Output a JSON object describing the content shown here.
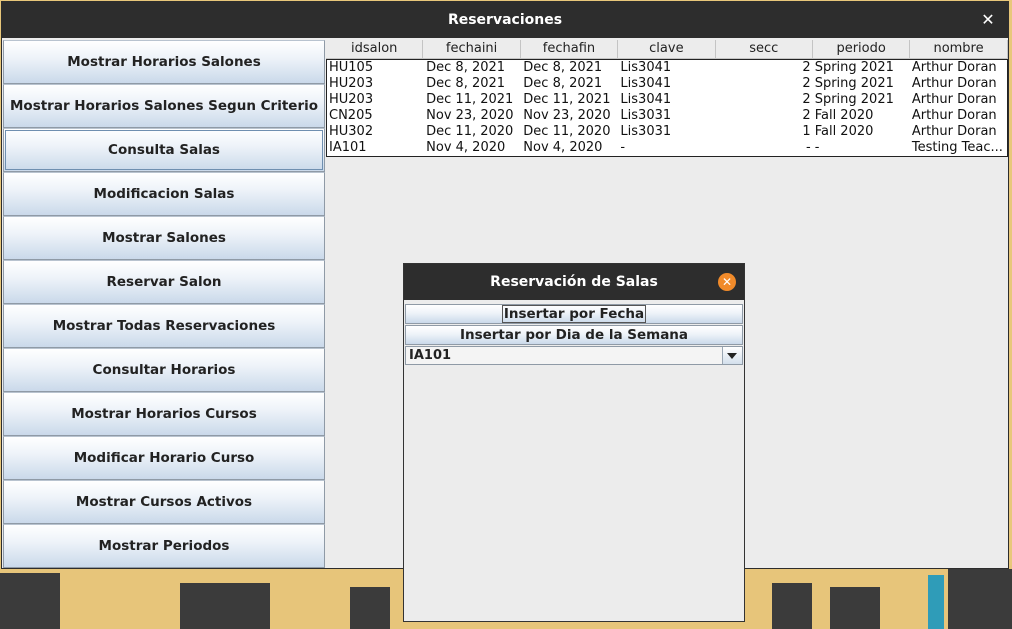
{
  "window": {
    "title": "Reservaciones",
    "close_glyph": "✕"
  },
  "menu": {
    "items": [
      "Mostrar Horarios Salones",
      "Mostrar Horarios Salones Segun Criterio",
      "Consulta Salas",
      "Modificacion Salas",
      "Mostrar Salones",
      "Reservar Salon",
      "Mostrar Todas Reservaciones",
      "Consultar Horarios",
      "Mostrar Horarios Cursos",
      "Modificar Horario Curso",
      "Mostrar Cursos Activos",
      "Mostrar Periodos"
    ]
  },
  "table": {
    "columns": [
      "idsalon",
      "fechaini",
      "fechafin",
      "clave",
      "secc",
      "periodo",
      "nombre"
    ],
    "rows": [
      [
        "HU105",
        "Dec 8, 2021",
        "Dec 8, 2021",
        "Lis3041",
        "2",
        "Spring 2021",
        "Arthur Doran"
      ],
      [
        "HU203",
        "Dec 8, 2021",
        "Dec 8, 2021",
        "Lis3041",
        "2",
        "Spring 2021",
        "Arthur Doran"
      ],
      [
        "HU203",
        "Dec 11, 2021",
        "Dec 11, 2021",
        "Lis3041",
        "2",
        "Spring 2021",
        "Arthur Doran"
      ],
      [
        "CN205",
        "Nov 23, 2020",
        "Nov 23, 2020",
        "Lis3031",
        "2",
        "Fall 2020",
        "Arthur Doran"
      ],
      [
        "HU302",
        "Dec 11, 2020",
        "Dec 11, 2020",
        "Lis3031",
        "1",
        "Fall 2020",
        "Arthur Doran"
      ],
      [
        "IA101",
        "Nov 4, 2020",
        "Nov 4, 2020",
        "-",
        "-",
        "-",
        "Testing Teac..."
      ]
    ]
  },
  "dialog": {
    "title": "Reservación de Salas",
    "close_glyph": "✕",
    "insert_by_date": "Insertar por Fecha",
    "insert_by_weekday": "Insertar por Dia de la Semana",
    "combo_value": "IA101"
  }
}
